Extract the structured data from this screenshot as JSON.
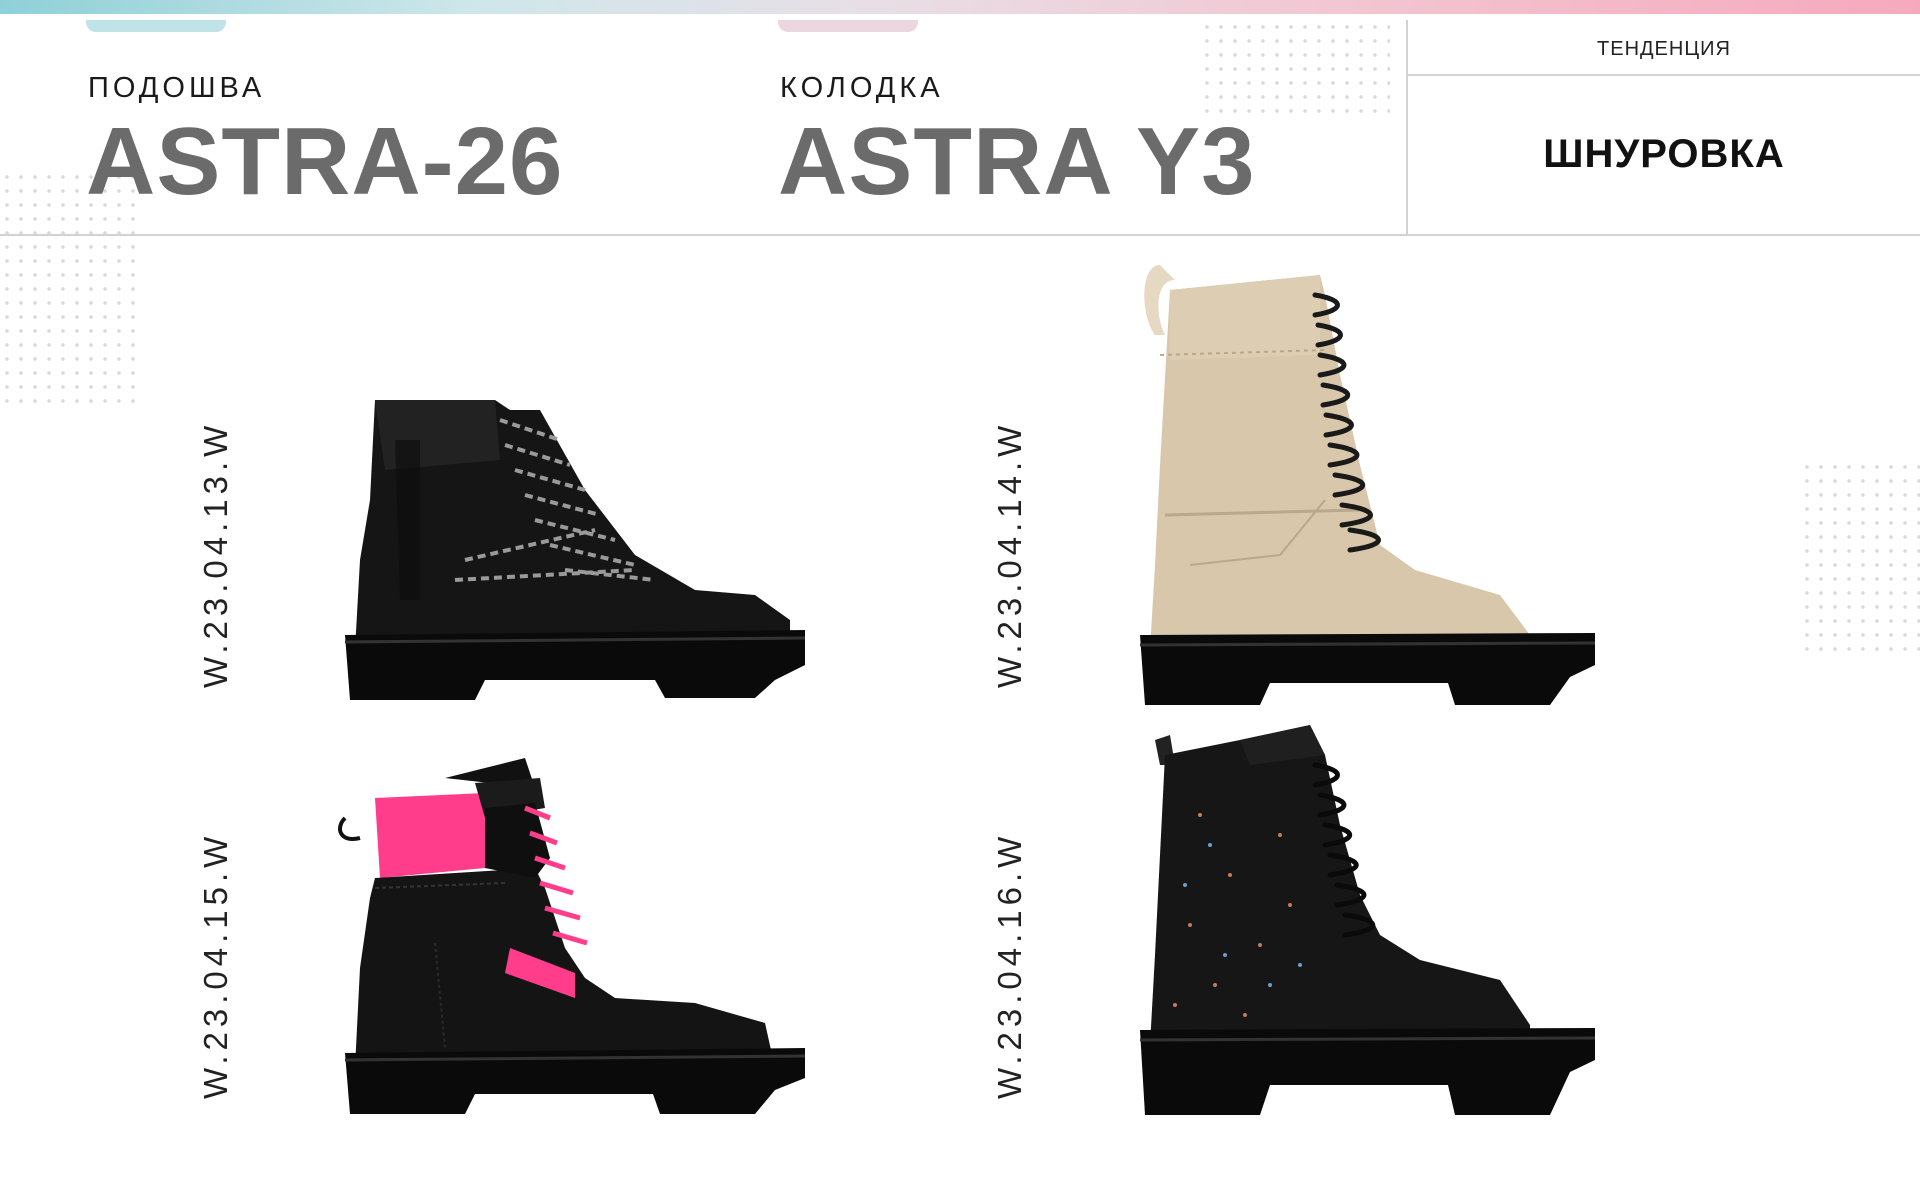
{
  "header": {
    "sole_label": "ПОДОШВА",
    "sole_name": "ASTRA-26",
    "last_label": "КОЛОДКА",
    "last_name": "ASTRA Y3",
    "trend_title": "ТЕНДЕНЦИЯ",
    "trend_value": "ШНУРОВКА"
  },
  "products": [
    {
      "code": "W.23.04.13.W",
      "color": "black",
      "image": "black-lace-up-boot-icon"
    },
    {
      "code": "W.23.04.14.W",
      "color": "beige",
      "image": "beige-lace-up-boot-icon"
    },
    {
      "code": "W.23.04.15.W",
      "color": "black with pink",
      "image": "black-pink-lace-up-boot-icon"
    },
    {
      "code": "W.23.04.16.W",
      "color": "black speckled",
      "image": "black-speckled-lace-up-boot-icon"
    }
  ],
  "colors": {
    "accent_pink": "#ff3d8b",
    "beige": "#d9c9ad",
    "title_gray": "#6b6b6b"
  }
}
